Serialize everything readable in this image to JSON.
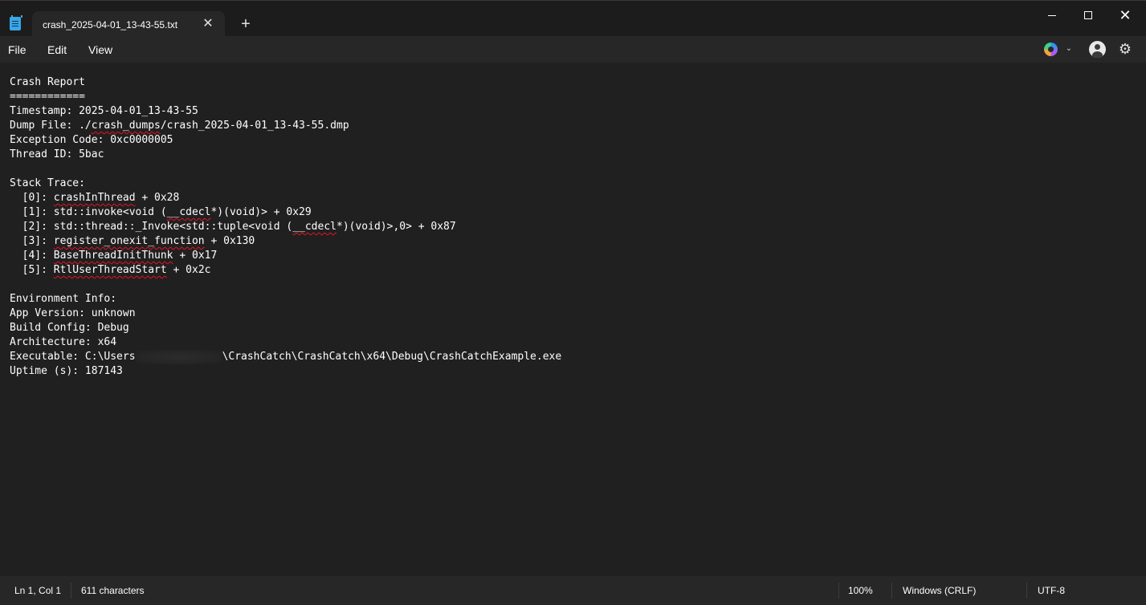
{
  "tab": {
    "title": "crash_2025-04-01_13-43-55.txt",
    "close_glyph": "✕"
  },
  "new_tab_glyph": "+",
  "window_controls": {
    "close_glyph": "✕"
  },
  "menu": {
    "file": "File",
    "edit": "Edit",
    "view": "View"
  },
  "toolbar": {
    "chevron_glyph": "⌄",
    "gear_glyph": "⚙"
  },
  "document": {
    "lines": [
      "Crash Report",
      "============",
      "Timestamp: 2025-04-01_13-43-55",
      "Dump File: ./crash_dumps/crash_2025-04-01_13-43-55.dmp",
      "Exception Code: 0xc0000005",
      "Thread ID: 5bac",
      "",
      "Stack Trace:",
      "  [0]: crashInThread + 0x28",
      "  [1]: std::invoke<void (__cdecl*)(void)> + 0x29",
      "  [2]: std::thread::_Invoke<std::tuple<void (__cdecl*)(void)>,0> + 0x87",
      "  [3]: register_onexit_function + 0x130",
      "  [4]: BaseThreadInitThunk + 0x17",
      "  [5]: RtlUserThreadStart + 0x2c",
      "",
      "Environment Info:",
      "App Version: unknown",
      "Build Config: Debug",
      "Architecture: x64",
      "Executable: C:\\Users",
      "Uptime (s): 187143"
    ],
    "executable_suffix": "\\CrashCatch\\CrashCatch\\x64\\Debug\\CrashCatchExample.exe"
  },
  "status": {
    "position": "Ln 1, Col 1",
    "characters": "611 characters",
    "zoom": "100%",
    "line_ending": "Windows (CRLF)",
    "encoding": "UTF-8"
  }
}
